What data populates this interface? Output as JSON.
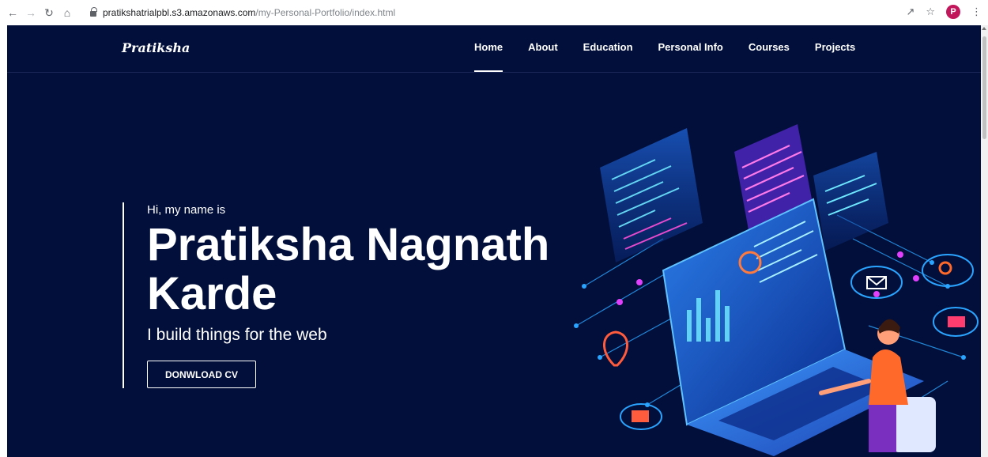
{
  "browser": {
    "url_host": "pratikshatrialpbl.s3.amazonaws.com",
    "url_path": "/my-Personal-Portfolio/index.html",
    "profile_initial": "P"
  },
  "site": {
    "logo": "Pratiksha",
    "nav": [
      {
        "label": "Home",
        "active": true
      },
      {
        "label": "About"
      },
      {
        "label": "Education"
      },
      {
        "label": "Personal Info"
      },
      {
        "label": "Courses"
      },
      {
        "label": "Projects"
      }
    ]
  },
  "hero": {
    "greeting": "Hi, my name is",
    "name": "Pratiksha Nagnath Karde",
    "tagline": "I build things for the web",
    "button_label": "DONWLOAD CV"
  },
  "colors": {
    "background": "#020f3a",
    "text": "#ffffff",
    "profile": "#c2185b"
  },
  "icons": {
    "back": "arrow-left-icon",
    "forward": "arrow-right-icon",
    "reload": "reload-icon",
    "home": "home-icon",
    "lock": "lock-icon",
    "share": "share-icon",
    "bookmark": "star-icon",
    "menu": "kebab-menu-icon"
  }
}
